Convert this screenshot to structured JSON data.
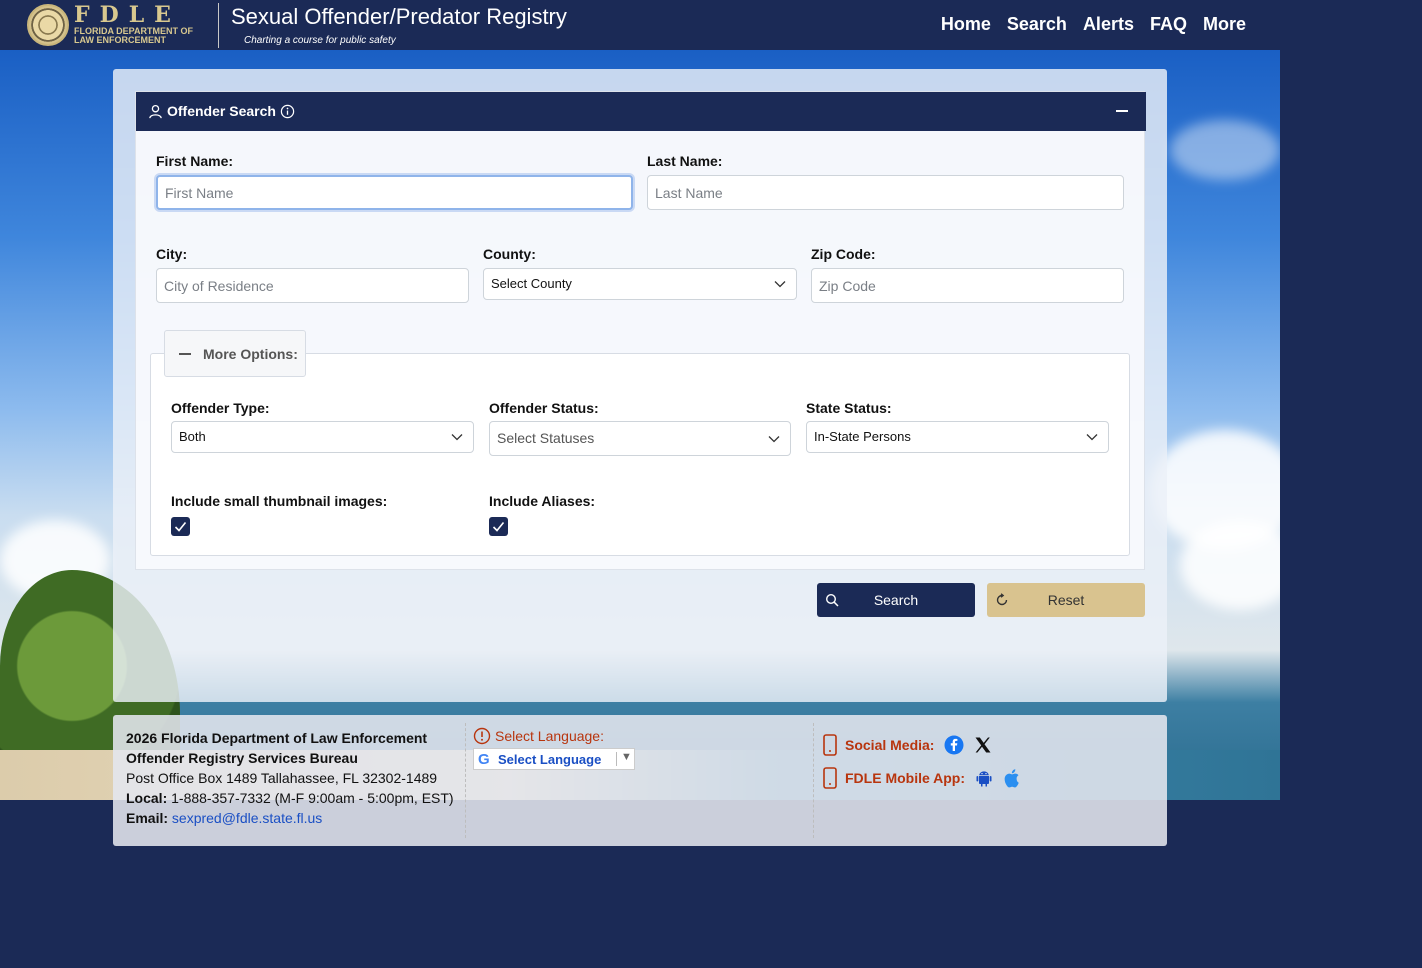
{
  "header": {
    "logo_text": "FDLE",
    "logo_subtitle": "FLORIDA DEPARTMENT OF LAW ENFORCEMENT",
    "title": "Sexual Offender/Predator Registry",
    "tagline": "Charting a course for public safety",
    "nav": [
      "Home",
      "Search",
      "Alerts",
      "FAQ",
      "More"
    ]
  },
  "search_card": {
    "title": "Offender Search",
    "first_name": {
      "label": "First Name:",
      "placeholder": "First Name",
      "value": ""
    },
    "last_name": {
      "label": "Last Name:",
      "placeholder": "Last Name",
      "value": ""
    },
    "city": {
      "label": "City:",
      "placeholder": "City of Residence",
      "value": ""
    },
    "county": {
      "label": "County:",
      "selected": "Select County"
    },
    "zip": {
      "label": "Zip Code:",
      "placeholder": "Zip Code",
      "value": ""
    },
    "more_options": {
      "label": "More Options:",
      "offender_type": {
        "label": "Offender Type:",
        "selected": "Both"
      },
      "offender_status": {
        "label": "Offender Status:",
        "selected": "Select Statuses"
      },
      "state_status": {
        "label": "State Status:",
        "selected": "In-State Persons"
      },
      "thumbnails": {
        "label": "Include small thumbnail images:",
        "checked": true
      },
      "aliases": {
        "label": "Include Aliases:",
        "checked": true
      }
    },
    "search_button": "Search",
    "reset_button": "Reset"
  },
  "footer": {
    "org": "2026 Florida Department of Law Enforcement",
    "bureau": "Offender Registry Services Bureau",
    "address": "Post Office Box 1489 Tallahassee, FL 32302-1489",
    "local_label": "Local:",
    "local_value": "1-888-357-7332 (M-F 9:00am - 5:00pm, EST)",
    "email_label": "Email:",
    "email_value": "sexpred@fdle.state.fl.us",
    "language_label": "Select Language:",
    "language_select": "Select Language",
    "social_label": "Social Media:",
    "app_label": "FDLE Mobile App:"
  },
  "colors": {
    "navy": "#1b2a56",
    "gold": "#d9c38f",
    "footer_accent": "#b8350e",
    "link": "#1a4fc4"
  }
}
